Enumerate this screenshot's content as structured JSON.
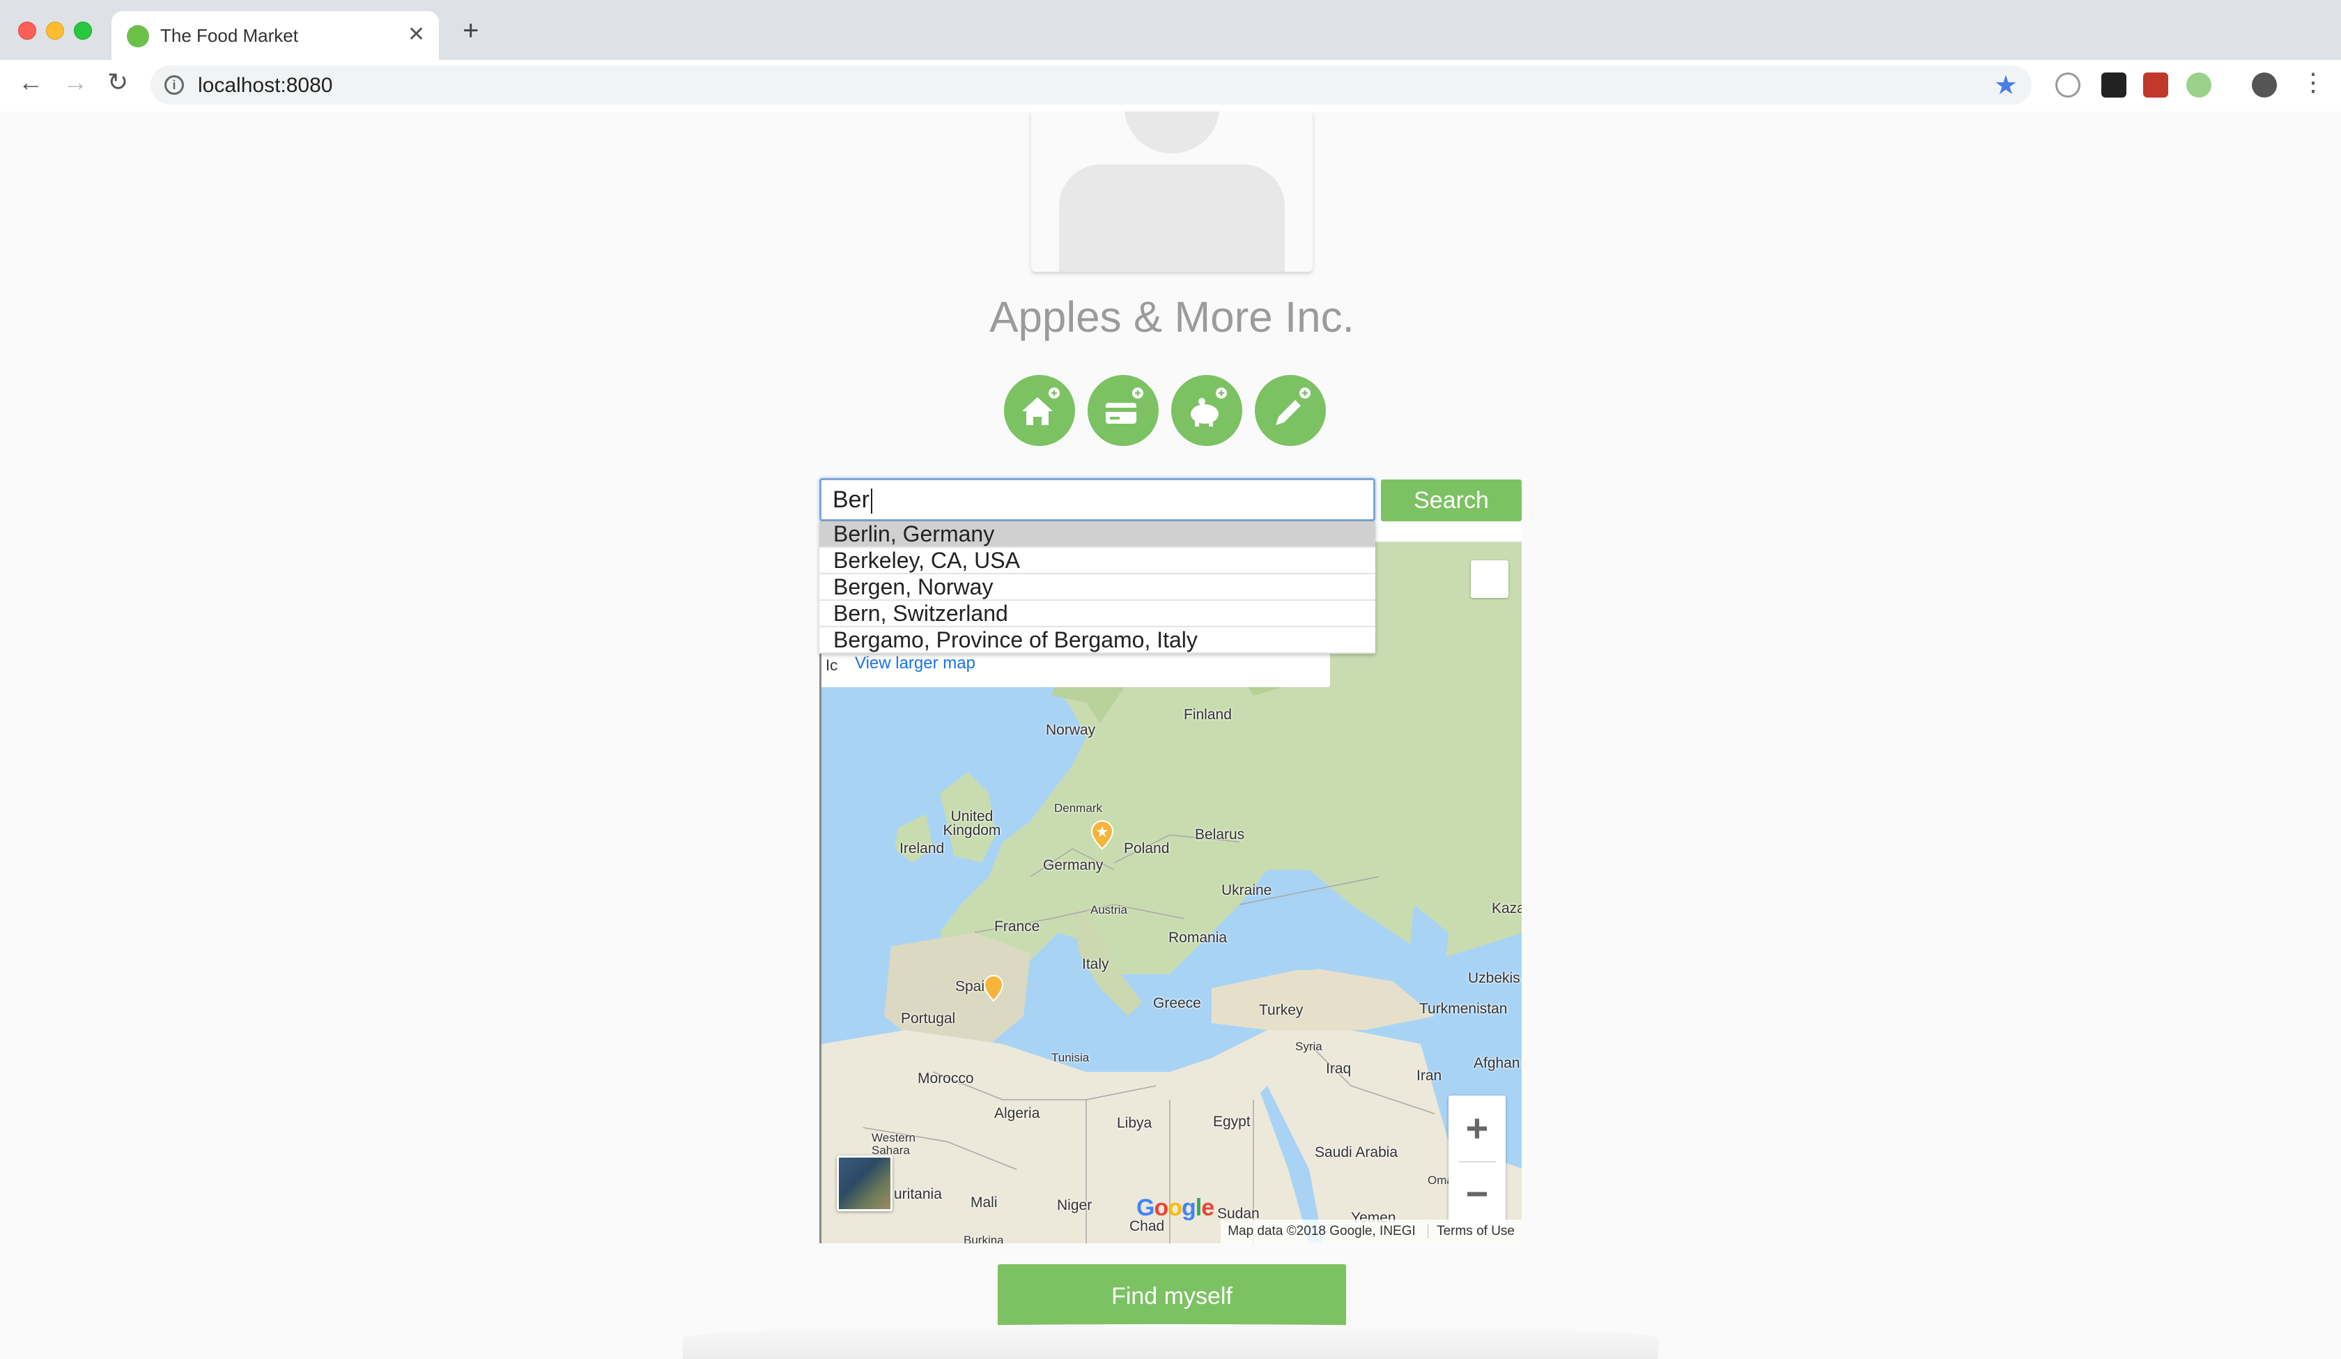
{
  "browser": {
    "tab_title": "The Food Market",
    "tab_close": "✕",
    "new_tab": "+",
    "url": "localhost:8080",
    "back": "←",
    "forward": "→",
    "reload": "↻",
    "info": "i",
    "bookmark": "★",
    "menu": "⋮"
  },
  "profile": {
    "company_name": "Apples & More Inc."
  },
  "actions": {
    "add_address": "add-home",
    "add_payment": "add-card",
    "add_savings": "add-piggy-bank",
    "add_note": "add-pencil"
  },
  "search": {
    "value": "Ber",
    "button_label": "Search",
    "suggestions": [
      "Berlin, Germany",
      "Berkeley, CA, USA",
      "Bergen, Norway",
      "Bern, Switzerland",
      "Bergamo, Province of Bergamo, Italy"
    ]
  },
  "map": {
    "larger_link": "View larger map",
    "card_icon": "Ic",
    "labels": {
      "norway": "Norway",
      "finland": "Finland",
      "denmark": "Denmark",
      "uk": "United Kingdom",
      "ireland": "Ireland",
      "germany": "Germany",
      "poland": "Poland",
      "belarus": "Belarus",
      "ukraine": "Ukraine",
      "austria": "Austria",
      "france": "France",
      "romania": "Romania",
      "italy": "Italy",
      "spain": "Spain",
      "portugal": "Portugal",
      "greece": "Greece",
      "turkey": "Turkey",
      "syria": "Syria",
      "iraq": "Iraq",
      "iran": "Iran",
      "morocco": "Morocco",
      "tunisia": "Tunisia",
      "algeria": "Algeria",
      "libya": "Libya",
      "egypt": "Egypt",
      "saudi": "Saudi Arabia",
      "western_sahara": "Western Sahara",
      "mauritania": "uritania",
      "mali": "Mali",
      "niger": "Niger",
      "chad": "Chad",
      "sudan": "Sudan",
      "yemen": "Yemen",
      "kazakh": "Kaza",
      "uzbek": "Uzbekis",
      "turkmen": "Turkmenistan",
      "afghan": "Afghan",
      "oman": "Oma",
      "burkina": "Burkina"
    },
    "zoom_in": "+",
    "zoom_out": "−",
    "google_logo": "Google",
    "attribution": "Map data ©2018 Google, INEGI",
    "terms": "Terms of Use"
  },
  "find_button": "Find myself",
  "colors": {
    "accent": "#7cc263",
    "water": "#a9d3f5",
    "land": "#e9e5d8",
    "forest": "#c7dcab"
  }
}
